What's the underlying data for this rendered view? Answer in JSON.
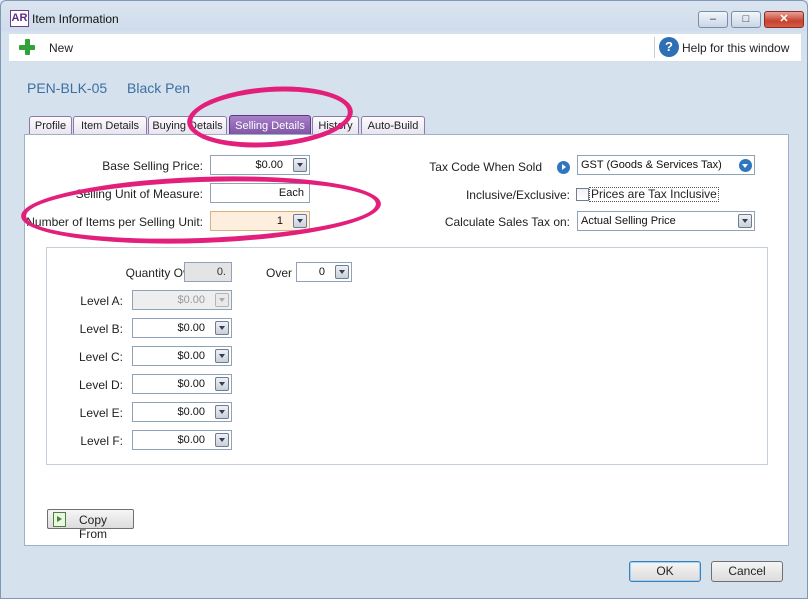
{
  "window": {
    "app_icon_text": "AR",
    "title": "Item Information"
  },
  "toolbar": {
    "new_label": "New",
    "help_label": "Help for this window"
  },
  "item": {
    "code": "PEN-BLK-05",
    "name": "Black Pen"
  },
  "tabs": [
    {
      "label": "Profile",
      "active": false
    },
    {
      "label": "Item Details",
      "active": false
    },
    {
      "label": "Buying Details",
      "active": false
    },
    {
      "label": "Selling Details",
      "active": true
    },
    {
      "label": "History",
      "active": false
    },
    {
      "label": "Auto-Build",
      "active": false
    }
  ],
  "selling": {
    "base_price_label": "Base Selling Price:",
    "base_price_value": "$0.00",
    "unit_label": "Selling Unit of Measure:",
    "unit_value": "Each",
    "items_per_unit_label": "Number of Items per Selling Unit:",
    "items_per_unit_value": "1",
    "tax_code_label": "Tax Code When Sold",
    "tax_code_value": "GST (Goods & Services Tax)",
    "inclusive_label": "Inclusive/Exclusive:",
    "inclusive_checkbox_label": "Prices are Tax Inclusive",
    "inclusive_checked": false,
    "calc_tax_label": "Calculate Sales Tax on:",
    "calc_tax_value": "Actual Selling Price"
  },
  "levels": {
    "qty_over_label": "Quantity Over:",
    "qty_over_value": "0.",
    "over_label": "Over",
    "over_value": "0",
    "rows": [
      {
        "label": "Level A:",
        "value": "$0.00",
        "disabled": true
      },
      {
        "label": "Level B:",
        "value": "$0.00",
        "disabled": false
      },
      {
        "label": "Level C:",
        "value": "$0.00",
        "disabled": false
      },
      {
        "label": "Level D:",
        "value": "$0.00",
        "disabled": false
      },
      {
        "label": "Level E:",
        "value": "$0.00",
        "disabled": false
      },
      {
        "label": "Level F:",
        "value": "$0.00",
        "disabled": false
      }
    ]
  },
  "buttons": {
    "copy_from": "Copy From",
    "ok": "OK",
    "cancel": "Cancel"
  },
  "colors": {
    "accent_tab": "#7b52a3",
    "annotation": "#e2207c",
    "title_blue": "#3b6fa3"
  }
}
